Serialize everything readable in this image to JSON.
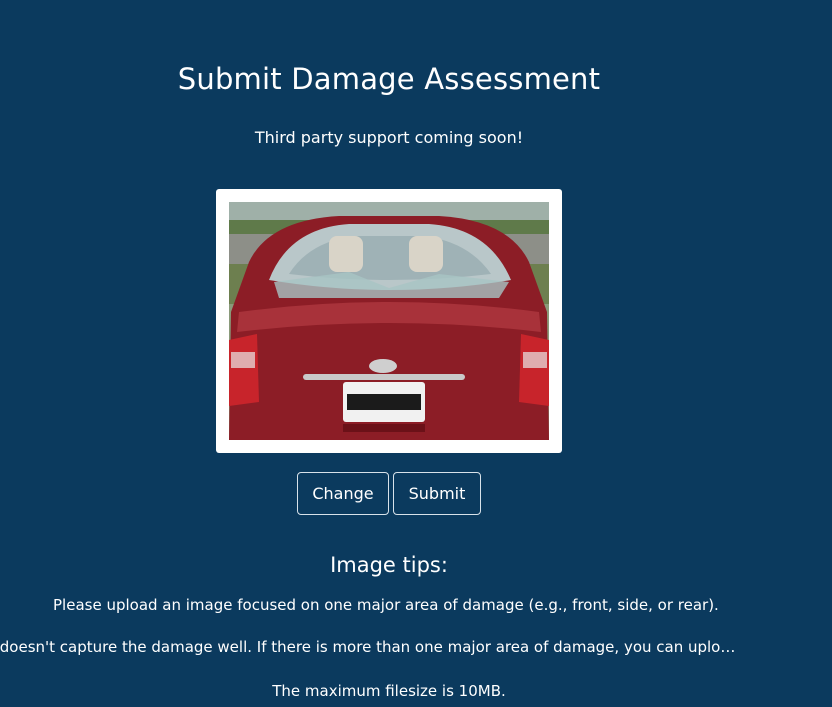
{
  "header": {
    "title": "Submit Damage Assessment",
    "notice": "Third party support coming soon!"
  },
  "upload": {
    "image_alt": "Uploaded photo of damaged red car rear"
  },
  "actions": {
    "change_label": "Change",
    "submit_label": "Submit"
  },
  "tips": {
    "heading": "Image tips:",
    "lines": [
      "Please upload an image focused on one major area of damage (e.g., front, side, or rear).",
      "…picture unless it doesn't capture the damage well. If there is more than one major area of damage, you can uplo…",
      "The maximum filesize is 10MB."
    ]
  },
  "colors": {
    "background": "#0b3a5e",
    "text": "#ffffff",
    "button_border": "#d8e2ea"
  }
}
